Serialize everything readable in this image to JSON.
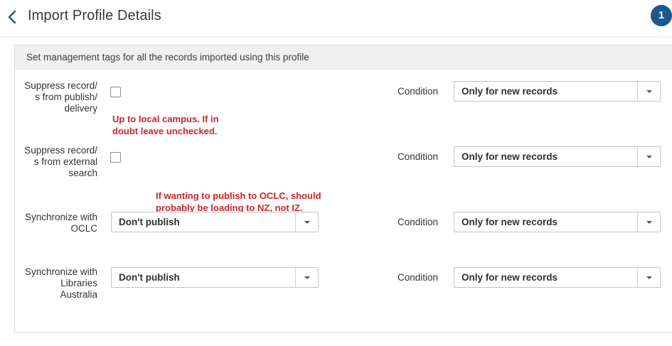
{
  "header": {
    "title": "Import Profile Details",
    "badge_count": "1"
  },
  "panel": {
    "heading": "Set management tags for all the records imported using this profile"
  },
  "rows": [
    {
      "label_lines": [
        "Suppress record/",
        "s from publish/",
        "delivery"
      ],
      "control": "checkbox",
      "checked": false,
      "condition_label": "Condition",
      "condition_value": "Only for new records"
    },
    {
      "label_lines": [
        "Suppress record/",
        "s from external",
        "search"
      ],
      "control": "checkbox",
      "checked": false,
      "condition_label": "Condition",
      "condition_value": "Only for new records"
    },
    {
      "label_lines": [
        "Synchronize with",
        "OCLC"
      ],
      "control": "select",
      "value": "Don't publish",
      "condition_label": "Condition",
      "condition_value": "Only for new records"
    },
    {
      "label_lines": [
        "Synchronize with",
        "Libraries",
        "Australia"
      ],
      "control": "select",
      "value": "Don't publish",
      "condition_label": "Condition",
      "condition_value": "Only for new records"
    }
  ],
  "annotations": [
    {
      "lines": [
        "Up to local campus. If in",
        "doubt leave unchecked."
      ]
    },
    {
      "lines": [
        "If wanting to publish to OCLC, should",
        "probably be loading to NZ, not IZ."
      ]
    }
  ],
  "colors": {
    "accent": "#1a5a8a",
    "annotation": "#c8262c",
    "panel_header_bg": "#f0f0f0"
  },
  "icons": {
    "back": "chevron-left-icon",
    "dropdown": "chevron-down-icon"
  }
}
